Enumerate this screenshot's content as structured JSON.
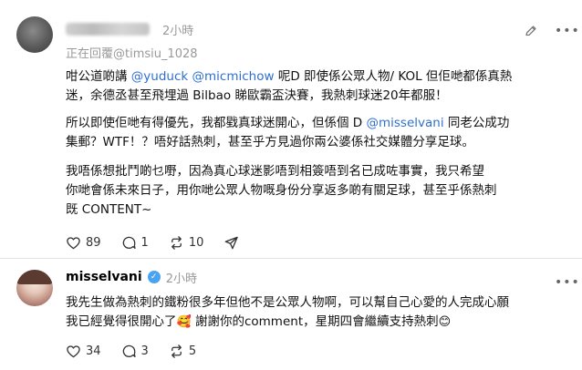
{
  "post1": {
    "username_redacted": true,
    "time": "2小時",
    "replying_to": "正在回覆@timsiu_1028",
    "mentions_line1": [
      "@yuduck",
      "@micmichow"
    ],
    "text_p1_prefix": "咁公道啲講",
    "text_p1_suffix": "呢D 即使係公眾人物/ KOL 但佢哋都係真熱",
    "text_p1_line2": "迷，余德丞甚至飛埋過 Bilbao 睇歐霸盃決賽，我熱刺球迷20年都服！",
    "text_p2_prefix": "所以即使佢哋有得優先，我都戥真球迷開心，但係個 D",
    "text_p2_mention": "@misselvani",
    "text_p2_suffix": "同老公成功",
    "text_p2_line2": "集郵？WTF！？唔好話熱刺，甚至乎方見過你兩公婆係社交媒體分享足球。",
    "text_p3_line1": "我唔係想批鬥啲乜嘢，因為真心球迷影唔到相簽唔到名已成咗事實，我只希望",
    "text_p3_line2": "你哋會係未來日子，用你哋公眾人物嘅身份分享返多啲有關足球，甚至乎係熱刺",
    "text_p3_line3": "既 CONTENT~",
    "likes": "89",
    "replies": "1",
    "reposts": "10"
  },
  "post2": {
    "username": "misselvani",
    "time": "2小時",
    "text_line1": "我先生做為熱刺的鐵粉很多年但他不是公眾人物啊，可以幫自己心愛的人完成心願",
    "text_line2_prefix": "我已經覺得很開心了",
    "text_line2_emoji1": "🥰",
    "text_line2_suffix": " 謝謝你的comment，星期四會繼續支持熱刺",
    "text_line2_emoji2": "😊",
    "likes": "34",
    "replies": "3",
    "reposts": "5"
  },
  "icons": {
    "more": "more-icon",
    "edit": "edit-icon",
    "like": "heart-icon",
    "reply": "comment-icon",
    "repost": "repost-icon",
    "share": "share-icon"
  },
  "colors": {
    "mention": "#2f6fd0",
    "muted": "#999999"
  }
}
